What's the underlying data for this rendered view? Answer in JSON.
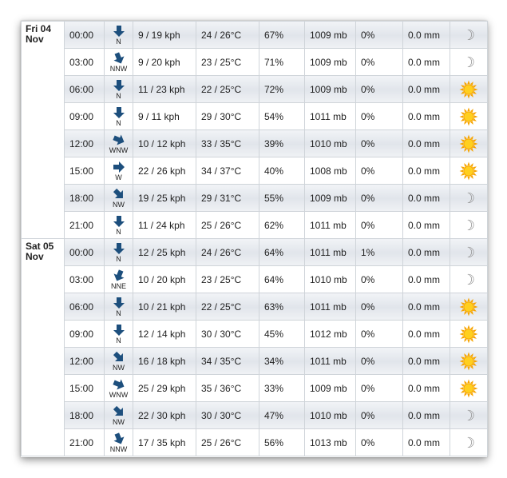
{
  "colors": {
    "sun": "#f6a400",
    "sun_core": "#ffcf1f",
    "arrow": "#1d4f7d",
    "moon": "#8c8c8c"
  },
  "days": [
    {
      "label_line1": "Fri 04",
      "label_line2": "Nov",
      "rows": [
        {
          "time": "00:00",
          "dir": "N",
          "angle": 0,
          "speed": "9 / 19 kph",
          "temp": "24 / 26°C",
          "hum": "67%",
          "pres": "1009 mb",
          "rain": "0%",
          "precip": "0.0 mm",
          "icon": "moon-icon"
        },
        {
          "time": "03:00",
          "dir": "NNW",
          "angle": -22.5,
          "speed": "9 / 20 kph",
          "temp": "23 / 25°C",
          "hum": "71%",
          "pres": "1009 mb",
          "rain": "0%",
          "precip": "0.0 mm",
          "icon": "moon-icon"
        },
        {
          "time": "06:00",
          "dir": "N",
          "angle": 0,
          "speed": "11 / 23 kph",
          "temp": "22 / 25°C",
          "hum": "72%",
          "pres": "1009 mb",
          "rain": "0%",
          "precip": "0.0 mm",
          "icon": "sun-icon"
        },
        {
          "time": "09:00",
          "dir": "N",
          "angle": 0,
          "speed": "9 / 11 kph",
          "temp": "29 / 30°C",
          "hum": "54%",
          "pres": "1011 mb",
          "rain": "0%",
          "precip": "0.0 mm",
          "icon": "sun-icon"
        },
        {
          "time": "12:00",
          "dir": "WNW",
          "angle": -67.5,
          "speed": "10 / 12 kph",
          "temp": "33 / 35°C",
          "hum": "39%",
          "pres": "1010 mb",
          "rain": "0%",
          "precip": "0.0 mm",
          "icon": "sun-icon"
        },
        {
          "time": "15:00",
          "dir": "W",
          "angle": -90,
          "speed": "22 / 26 kph",
          "temp": "34 / 37°C",
          "hum": "40%",
          "pres": "1008 mb",
          "rain": "0%",
          "precip": "0.0 mm",
          "icon": "sun-icon"
        },
        {
          "time": "18:00",
          "dir": "NW",
          "angle": -45,
          "speed": "19 / 25 kph",
          "temp": "29 / 31°C",
          "hum": "55%",
          "pres": "1009 mb",
          "rain": "0%",
          "precip": "0.0 mm",
          "icon": "moon-icon"
        },
        {
          "time": "21:00",
          "dir": "N",
          "angle": 0,
          "speed": "11 / 24 kph",
          "temp": "25 / 26°C",
          "hum": "62%",
          "pres": "1011 mb",
          "rain": "0%",
          "precip": "0.0 mm",
          "icon": "moon-icon"
        }
      ]
    },
    {
      "label_line1": "Sat 05",
      "label_line2": "Nov",
      "rows": [
        {
          "time": "00:00",
          "dir": "N",
          "angle": 0,
          "speed": "12 / 25 kph",
          "temp": "24 / 26°C",
          "hum": "64%",
          "pres": "1011 mb",
          "rain": "1%",
          "precip": "0.0 mm",
          "icon": "moon-icon"
        },
        {
          "time": "03:00",
          "dir": "NNE",
          "angle": 22.5,
          "speed": "10 / 20 kph",
          "temp": "23 / 25°C",
          "hum": "64%",
          "pres": "1010 mb",
          "rain": "0%",
          "precip": "0.0 mm",
          "icon": "moon-icon"
        },
        {
          "time": "06:00",
          "dir": "N",
          "angle": 0,
          "speed": "10 / 21 kph",
          "temp": "22 / 25°C",
          "hum": "63%",
          "pres": "1011 mb",
          "rain": "0%",
          "precip": "0.0 mm",
          "icon": "sun-icon"
        },
        {
          "time": "09:00",
          "dir": "N",
          "angle": 0,
          "speed": "12 / 14 kph",
          "temp": "30 / 30°C",
          "hum": "45%",
          "pres": "1012 mb",
          "rain": "0%",
          "precip": "0.0 mm",
          "icon": "sun-icon"
        },
        {
          "time": "12:00",
          "dir": "NW",
          "angle": -45,
          "speed": "16 / 18 kph",
          "temp": "34 / 35°C",
          "hum": "34%",
          "pres": "1011 mb",
          "rain": "0%",
          "precip": "0.0 mm",
          "icon": "sun-icon"
        },
        {
          "time": "15:00",
          "dir": "WNW",
          "angle": -67.5,
          "speed": "25 / 29 kph",
          "temp": "35 / 36°C",
          "hum": "33%",
          "pres": "1009 mb",
          "rain": "0%",
          "precip": "0.0 mm",
          "icon": "sun-icon"
        },
        {
          "time": "18:00",
          "dir": "NW",
          "angle": -45,
          "speed": "22 / 30 kph",
          "temp": "30 / 30°C",
          "hum": "47%",
          "pres": "1010 mb",
          "rain": "0%",
          "precip": "0.0 mm",
          "icon": "moon-icon"
        },
        {
          "time": "21:00",
          "dir": "NNW",
          "angle": -22.5,
          "speed": "17 / 35 kph",
          "temp": "25 / 26°C",
          "hum": "56%",
          "pres": "1013 mb",
          "rain": "0%",
          "precip": "0.0 mm",
          "icon": "moon-icon"
        }
      ]
    }
  ]
}
